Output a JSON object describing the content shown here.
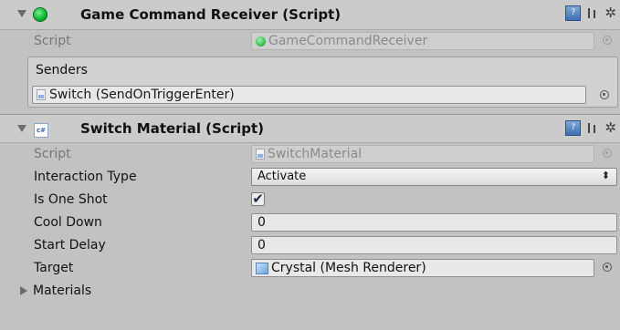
{
  "components": [
    {
      "title": "Game Command Receiver (Script)",
      "script_label": "Script",
      "script_value": "GameCommandReceiver",
      "senders_label": "Senders",
      "senders_item": "Switch (SendOnTriggerEnter)"
    },
    {
      "title": "Switch Material (Script)",
      "script_label": "Script",
      "script_value": "SwitchMaterial",
      "cs_icon_text": "c#",
      "fields": {
        "interaction_type_label": "Interaction Type",
        "interaction_type_value": "Activate",
        "is_one_shot_label": "Is One Shot",
        "is_one_shot_checked": true,
        "cool_down_label": "Cool Down",
        "cool_down_value": "0",
        "start_delay_label": "Start Delay",
        "start_delay_value": "0",
        "target_label": "Target",
        "target_value": "Crystal (Mesh Renderer)",
        "materials_label": "Materials"
      }
    }
  ],
  "icons": {
    "help": "book-icon",
    "presets": "preset-icon",
    "settings": "gear-icon"
  },
  "glyphs": {
    "check": "✔",
    "popup_arrow": "⬍",
    "gear": "✲",
    "help": "?"
  }
}
